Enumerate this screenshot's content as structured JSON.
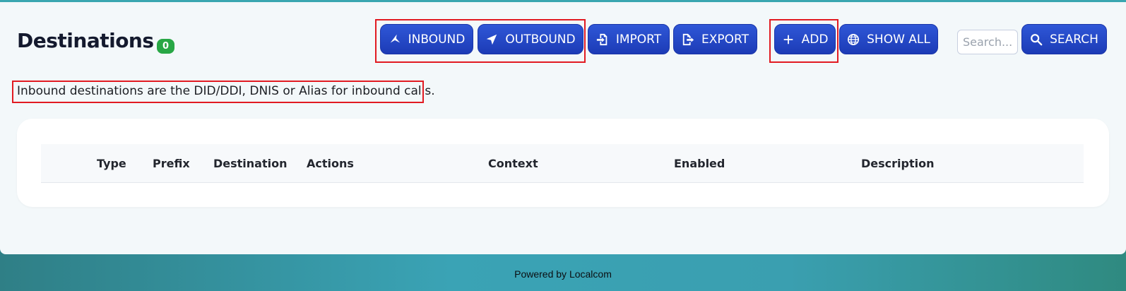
{
  "header": {
    "title": "Destinations",
    "count": "0"
  },
  "toolbar": {
    "inbound_label": "INBOUND",
    "outbound_label": "OUTBOUND",
    "import_label": "IMPORT",
    "export_label": "EXPORT",
    "add_label": "ADD",
    "show_all_label": "SHOW ALL",
    "search_placeholder": "Search...",
    "search_value": "",
    "search_label": "SEARCH"
  },
  "description": "Inbound destinations are the DID/DDI, DNIS or Alias for inbound calls.",
  "table": {
    "columns": [
      "Type",
      "Prefix",
      "Destination",
      "Actions",
      "Context",
      "Enabled",
      "Description"
    ],
    "rows": []
  },
  "footer": {
    "text": "Powered by Localcom"
  },
  "icons": {
    "inbound": "inbound-arrow-icon",
    "outbound": "location-arrow-icon",
    "import": "file-import-icon",
    "export": "file-export-icon",
    "add": "plus-icon",
    "show_all": "globe-icon",
    "search": "magnifier-icon"
  },
  "colors": {
    "button_primary": "#2441c4",
    "badge": "#28a745",
    "highlight": "#e11b22",
    "footer_bg": "#3aa3b5"
  }
}
